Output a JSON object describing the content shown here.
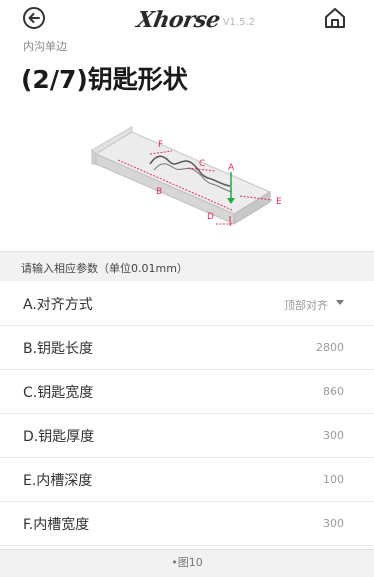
{
  "header": {
    "logo_text": "Xhorse",
    "version": "V1.5.2",
    "back_icon": "back-arrow-circle-icon",
    "home_icon": "home-icon"
  },
  "page": {
    "subtitle": "内沟单边",
    "title": "(2/7)钥匙形状"
  },
  "diagram": {
    "labels": {
      "a": "A",
      "b": "B",
      "c": "C",
      "d": "D",
      "e": "E",
      "f": "F"
    },
    "colors": {
      "dimension": "#e0305a",
      "arrow": "#22aa44",
      "body": "#cccccc"
    }
  },
  "section": {
    "header": "请输入相应参数（单位0.01mm）"
  },
  "params": [
    {
      "label": "A.对齐方式",
      "value": "顶部对齐"
    },
    {
      "label": "B.钥匙长度",
      "value": "2800"
    },
    {
      "label": "C.钥匙宽度",
      "value": "860"
    },
    {
      "label": "D.钥匙厚度",
      "value": "300"
    },
    {
      "label": "E.内槽深度",
      "value": "100"
    },
    {
      "label": "F.内槽宽度",
      "value": "300"
    }
  ],
  "footer": {
    "text": "•图10"
  }
}
